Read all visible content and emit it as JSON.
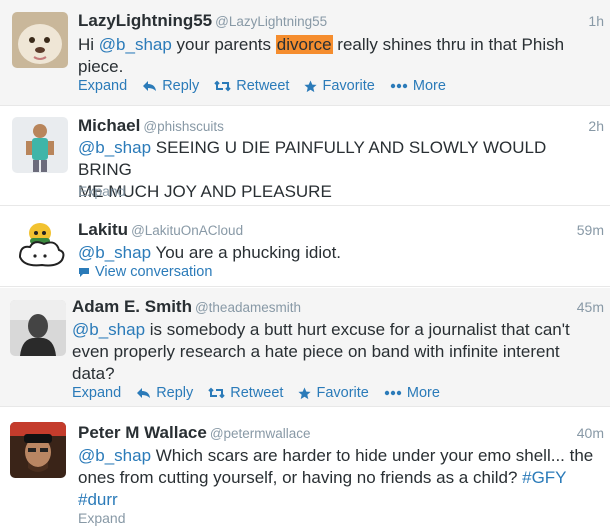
{
  "tweets": [
    {
      "fullname": "LazyLightning55",
      "username": "@LazyLightning55",
      "time": "1h",
      "text_parts": [
        "Hi ",
        "@b_shap",
        " your parents ",
        "divorce",
        " really shines thru in that Phish",
        "piece."
      ],
      "actions": {
        "expand": "Expand",
        "reply": "Reply",
        "retweet": "Retweet",
        "favorite": "Favorite",
        "more": "More"
      }
    },
    {
      "fullname": "Michael",
      "username": "@phishscuits",
      "time": "2h",
      "mention": "@b_shap",
      "line1": " SEEING U DIE PAINFULLY AND SLOWLY WOULD BRING",
      "line2": "ME MUCH JOY AND PLEASURE",
      "expand": "Expand"
    },
    {
      "fullname": "Lakitu",
      "username": "@LakituOnACloud",
      "time": "59m",
      "mention": "@b_shap",
      "line1": " You are a phucking idiot.",
      "view_conversation": "View conversation"
    },
    {
      "fullname": "Adam E. Smith",
      "username": "@theadamesmith",
      "time": "45m",
      "mention": "@b_shap",
      "line1": " is somebody a butt hurt excuse for a journalist that can't",
      "line2": "even properly research a hate piece on band with infinite interent",
      "line3": "data?",
      "actions": {
        "expand": "Expand",
        "reply": "Reply",
        "retweet": "Retweet",
        "favorite": "Favorite",
        "more": "More"
      }
    },
    {
      "fullname": "Peter M Wallace",
      "username": "@petermwallace",
      "time": "40m",
      "mention": "@b_shap",
      "line1": " Which scars are harder to hide under your emo shell... the",
      "line2": "ones from cutting yourself, or having no friends as a child? ",
      "hashtag1": "#GFY",
      "hashtag2": "#durr",
      "expand": "Expand"
    }
  ],
  "colors": {
    "link": "#2b7bb9",
    "highlight": "#f58d2e",
    "muted": "#8899a6"
  }
}
